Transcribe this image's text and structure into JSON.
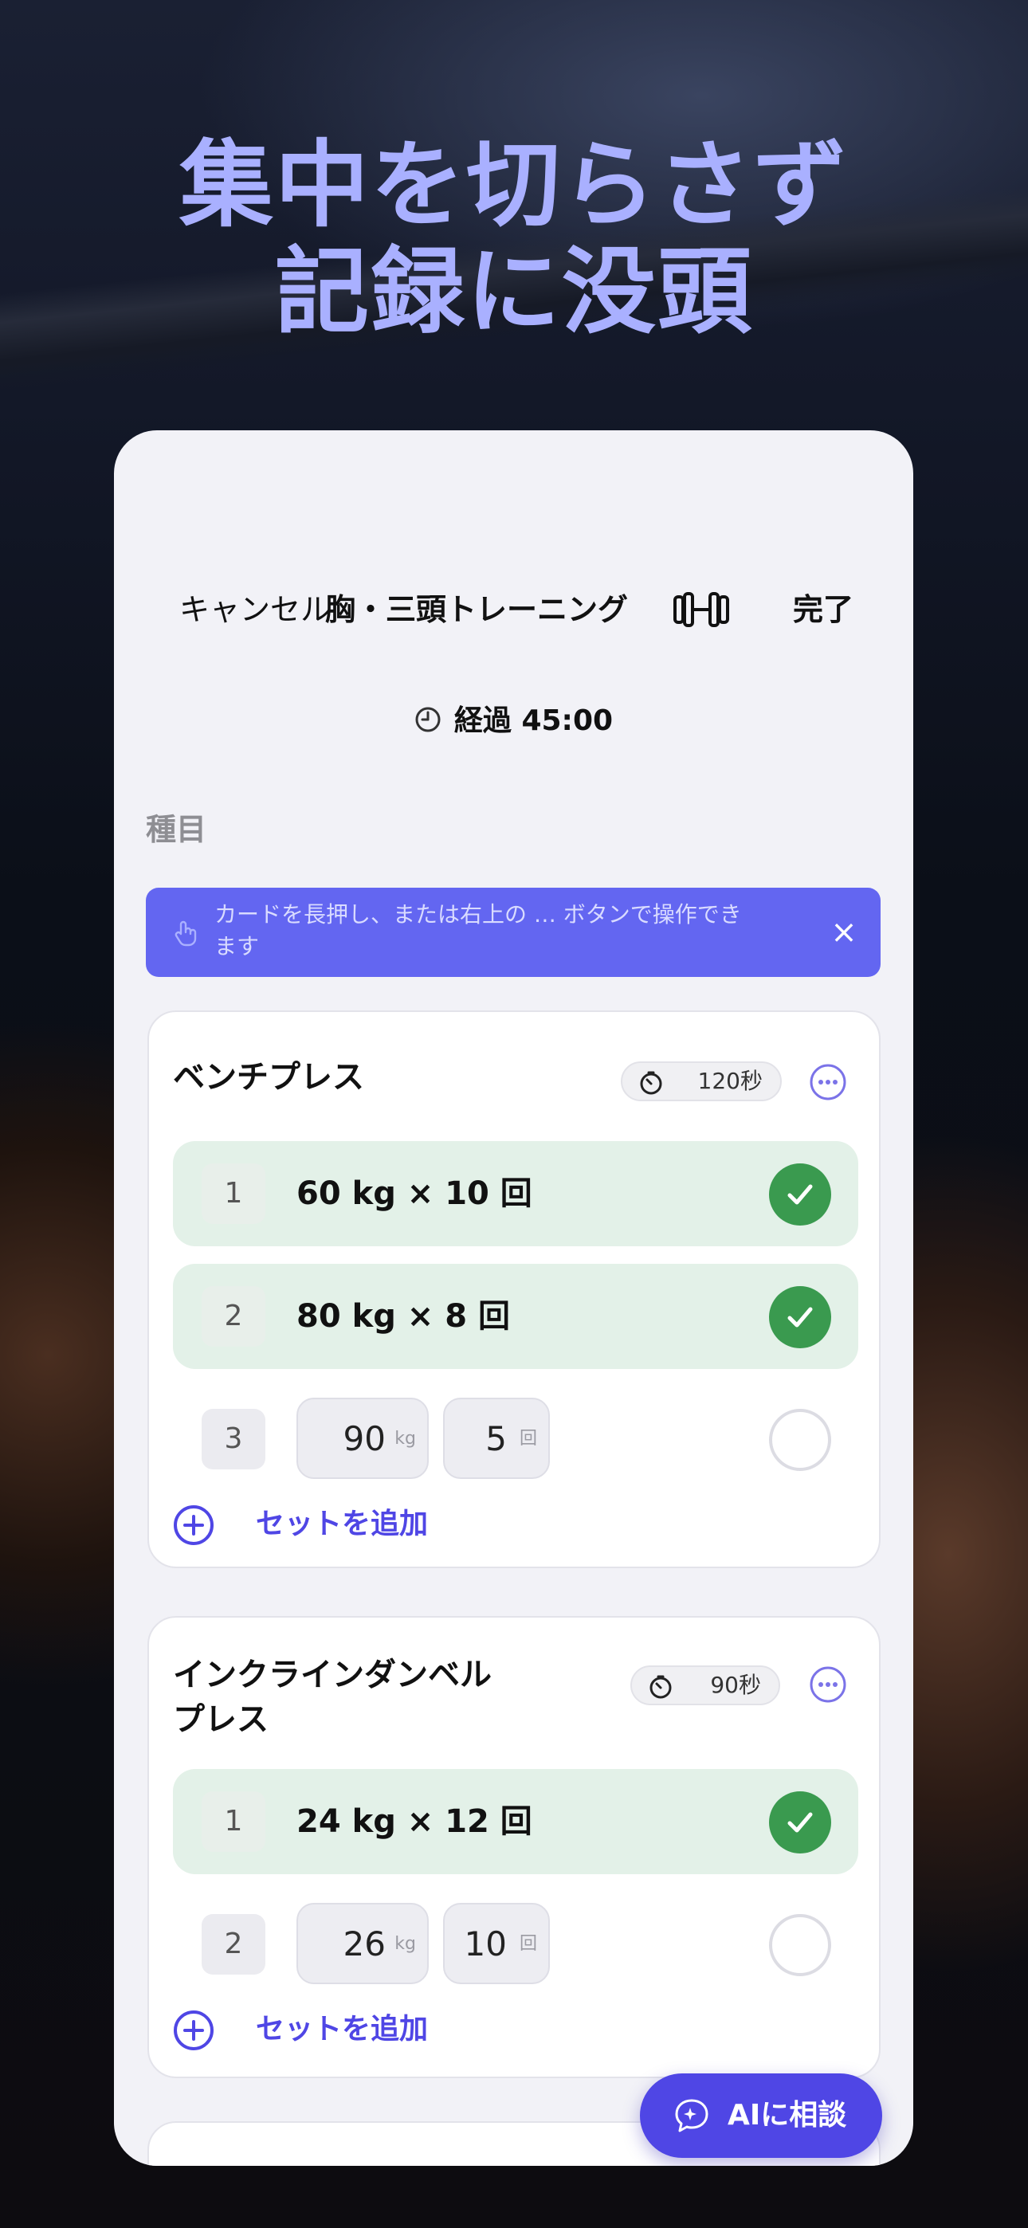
{
  "headline": {
    "line1": "集中を切らさず",
    "line2": "記録に没頭"
  },
  "nav": {
    "cancel": "キャンセル",
    "title": "胸・三頭トレーニング",
    "done": "完了",
    "title_icon": "dumbbell-icon"
  },
  "elapsed": {
    "label": "経過 45:00",
    "icon": "clock-icon"
  },
  "section_label": "種目",
  "tip": {
    "text": "カードを長押し、または右上の … ボタンで操作できます",
    "close": "×",
    "icon": "hand-tap-icon"
  },
  "exercises": [
    {
      "name": "ベンチプレス",
      "rest": "120秒",
      "sets": [
        {
          "number": "1",
          "summary": "60 kg × 10 回",
          "done": true
        },
        {
          "number": "2",
          "summary": "80 kg × 8 回",
          "done": true
        },
        {
          "number": "3",
          "weight": "90",
          "weight_unit": "kg",
          "reps": "5",
          "reps_unit": "回",
          "done": false
        }
      ],
      "add_set": "セットを追加"
    },
    {
      "name": "インクラインダンベルプレス",
      "name_line1": "インクラインダンベル",
      "name_line2": "プレス",
      "rest": "90秒",
      "sets": [
        {
          "number": "1",
          "summary": "24 kg × 12 回",
          "done": true
        },
        {
          "number": "2",
          "weight": "26",
          "weight_unit": "kg",
          "reps": "10",
          "reps_unit": "回",
          "done": false
        }
      ],
      "add_set": "セットを追加"
    }
  ],
  "ai_button": {
    "label": "AIに相談",
    "icon": "ai-chat-icon"
  },
  "colors": {
    "accent": "#4f46e5",
    "tip_bg": "#6366f1",
    "done_bg": "#e3f1e8",
    "check": "#3a9a4f",
    "headline": "#a9b0ff"
  }
}
